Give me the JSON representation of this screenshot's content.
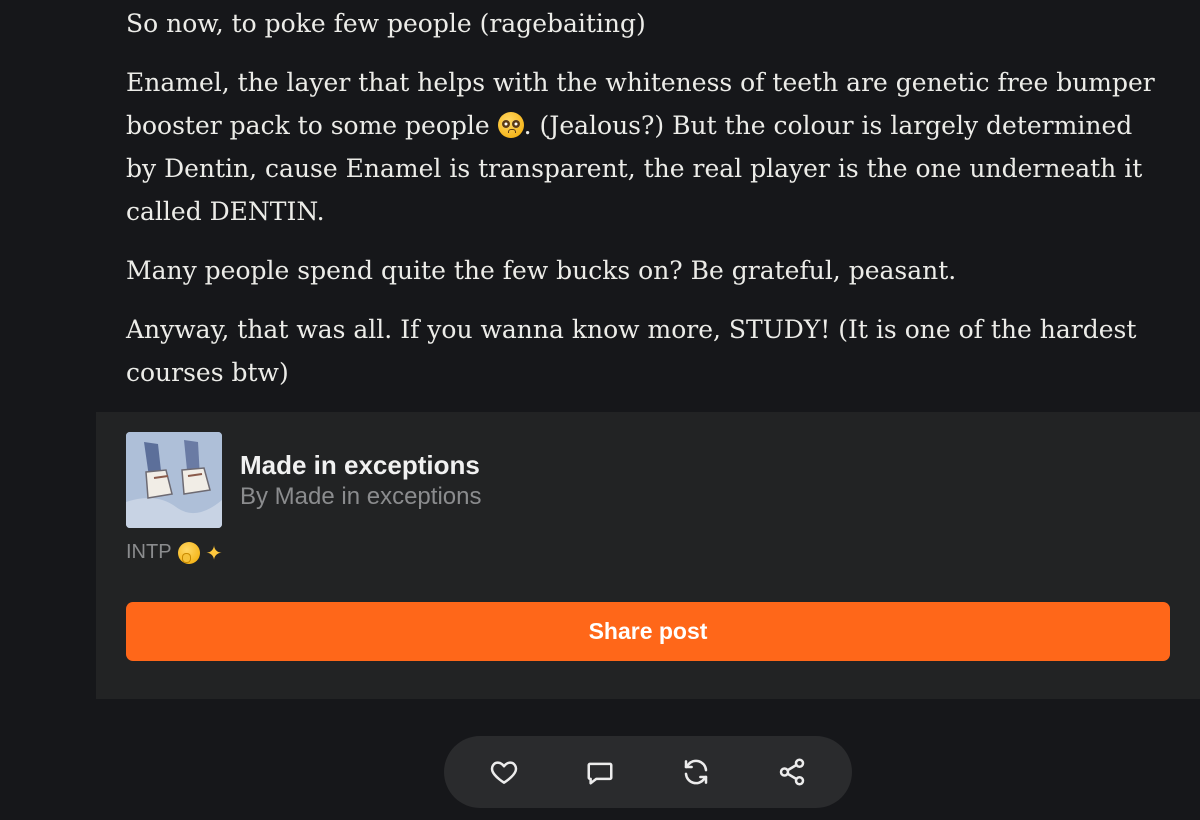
{
  "article": {
    "p1": "So now, to poke few people (ragebaiting)",
    "p2_before_emoji": "Enamel, the layer that helps with the whiteness of teeth are genetic free bumper booster pack to some people ",
    "p2_emoji_name": "pleading-face-emoji",
    "p2_after_emoji": ". (Jealous?) But the colour is largely determined by Dentin, cause Enamel is transparent, the real player is the one underneath it called DENTIN.",
    "p3": "Many people spend quite the few bucks on? Be grateful, peasant.",
    "p4": "Anyway, that was all. If you wanna know more, STUDY! (It is one of the hardest courses btw)"
  },
  "publication": {
    "name": "Made in exceptions",
    "byline": "By Made in exceptions",
    "description": "INTP",
    "description_icons": [
      "shushing-face-emoji",
      "sparkles-icon"
    ],
    "share_label": "Share post",
    "accent_color": "#ff6719"
  },
  "actions": {
    "icons": [
      "heart-icon",
      "comment-icon",
      "restack-icon",
      "share-icon"
    ]
  }
}
